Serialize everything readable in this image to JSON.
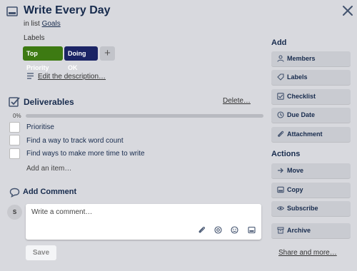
{
  "card": {
    "title": "Write Every Day",
    "in_list_prefix": "in list",
    "list_name": "Goals"
  },
  "labels": {
    "heading": "Labels",
    "items": [
      {
        "text": "Top Priority",
        "color": "#3d7a12"
      },
      {
        "text": "Doing OK",
        "color": "#1b2465"
      }
    ],
    "add_glyph": "+"
  },
  "description": {
    "edit_link": "Edit the description…"
  },
  "checklist": {
    "title": "Deliverables",
    "delete_link": "Delete…",
    "percent_label": "0%",
    "progress": 0,
    "items": [
      {
        "text": "Prioritise",
        "checked": false
      },
      {
        "text": "Find a way to track word count",
        "checked": false
      },
      {
        "text": "Find ways to make more time to write",
        "checked": false
      }
    ],
    "add_item": "Add an item…"
  },
  "comment": {
    "title": "Add Comment",
    "avatar_initial": "S",
    "placeholder": "Write a comment…",
    "save_label": "Save",
    "icons": [
      "paperclip-icon",
      "at-icon",
      "emoji-icon",
      "card-icon"
    ]
  },
  "sidebar": {
    "add_heading": "Add",
    "add_buttons": [
      {
        "label": "Members",
        "icon": "person-icon"
      },
      {
        "label": "Labels",
        "icon": "tag-icon"
      },
      {
        "label": "Checklist",
        "icon": "checkbox-icon"
      },
      {
        "label": "Due Date",
        "icon": "clock-icon"
      },
      {
        "label": "Attachment",
        "icon": "paperclip-icon"
      }
    ],
    "actions_heading": "Actions",
    "action_buttons": [
      {
        "label": "Move",
        "icon": "arrow-right-icon"
      },
      {
        "label": "Copy",
        "icon": "card-icon"
      },
      {
        "label": "Subscribe",
        "icon": "eye-icon"
      },
      {
        "label": "Archive",
        "icon": "archive-icon"
      }
    ],
    "share_link": "Share and more…"
  }
}
